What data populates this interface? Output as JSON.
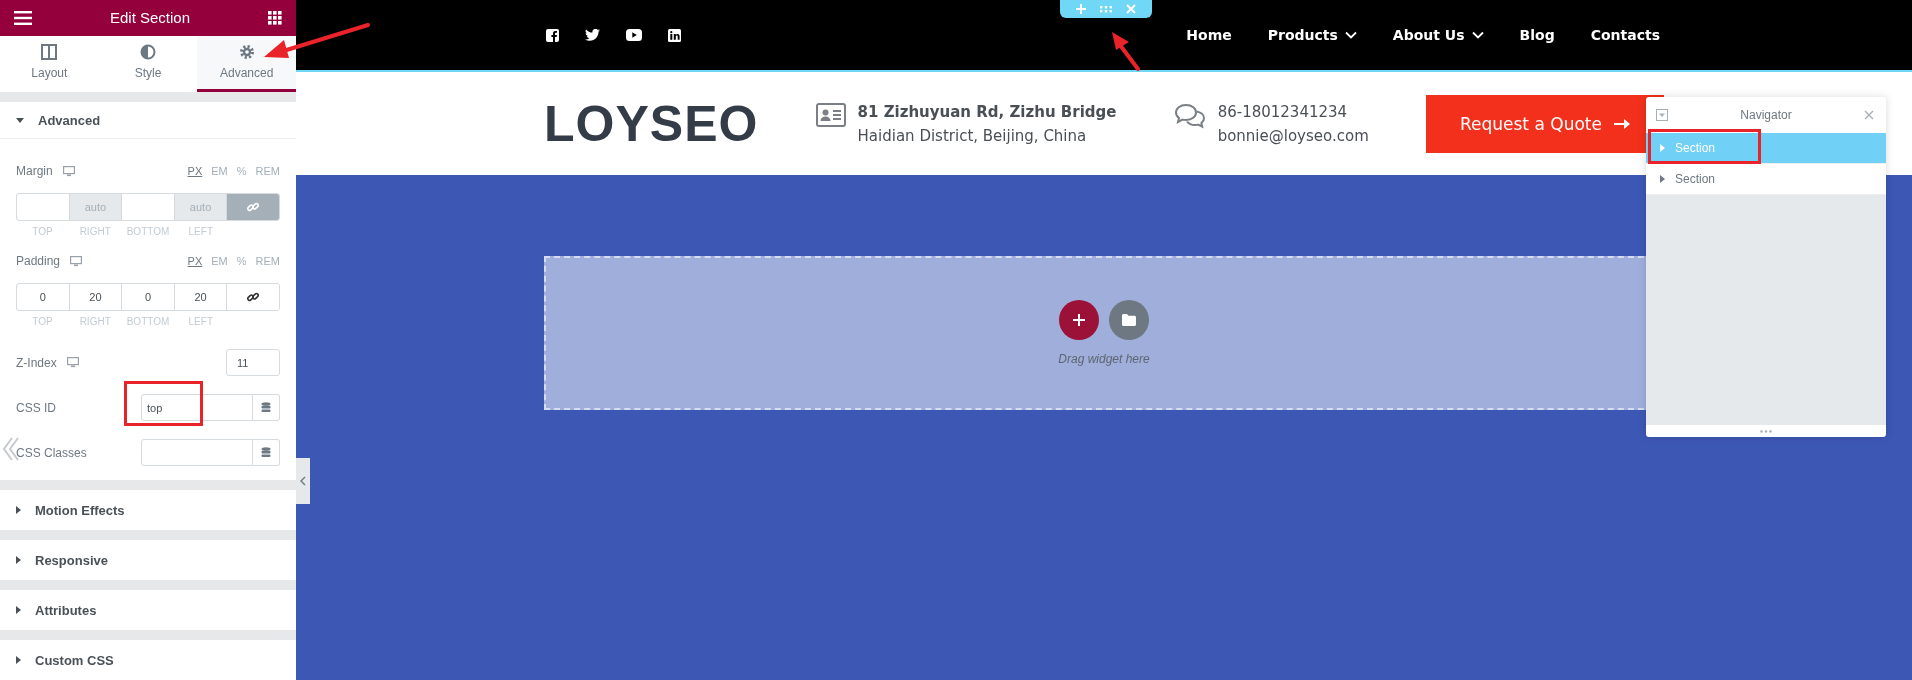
{
  "panel": {
    "title": "Edit Section",
    "tabs": [
      {
        "label": "Layout",
        "kind": "layout",
        "selected": false
      },
      {
        "label": "Style",
        "kind": "style",
        "selected": false
      },
      {
        "label": "Advanced",
        "kind": "advanced",
        "selected": true
      }
    ],
    "open_section": {
      "title": "Advanced",
      "expanded": true,
      "margin": {
        "label": "Margin",
        "units": [
          {
            "label": "PX",
            "selected": true
          },
          {
            "label": "EM",
            "selected": false
          },
          {
            "label": "%",
            "selected": false
          },
          {
            "label": "REM",
            "selected": false
          }
        ],
        "fields": [
          {
            "label": "TOP",
            "disabled": false
          },
          {
            "label": "RIGHT",
            "placeholder": "auto",
            "disabled": true
          },
          {
            "label": "BOTTOM",
            "disabled": false
          },
          {
            "label": "LEFT",
            "placeholder": "auto",
            "disabled": true
          }
        ],
        "linked": true
      },
      "padding": {
        "label": "Padding",
        "units": [
          {
            "label": "PX",
            "selected": true
          },
          {
            "label": "EM",
            "selected": false
          },
          {
            "label": "%",
            "selected": false
          },
          {
            "label": "REM",
            "selected": false
          }
        ],
        "fields": [
          {
            "label": "TOP",
            "value": "0",
            "disabled": false
          },
          {
            "label": "RIGHT",
            "value": "20",
            "disabled": false
          },
          {
            "label": "BOTTOM",
            "value": "0",
            "disabled": false
          },
          {
            "label": "LEFT",
            "value": "20",
            "disabled": false
          }
        ],
        "linked": false
      },
      "z_index": {
        "label": "Z-Index",
        "value": "11"
      },
      "css_id": {
        "label": "CSS ID",
        "value": "top"
      },
      "css_classes": {
        "label": "CSS Classes"
      }
    },
    "sections": [
      {
        "title": "Motion Effects",
        "expanded": false
      },
      {
        "title": "Responsive",
        "expanded": false
      },
      {
        "title": "Attributes",
        "expanded": false
      },
      {
        "title": "Custom CSS",
        "expanded": false
      }
    ]
  },
  "site": {
    "nav": [
      {
        "label": "Home",
        "dropdown": false
      },
      {
        "label": "Products",
        "dropdown": true
      },
      {
        "label": "About Us",
        "dropdown": true
      },
      {
        "label": "Blog",
        "dropdown": false
      },
      {
        "label": "Contacts",
        "dropdown": false
      }
    ],
    "logo": "LOYSEO",
    "address": [
      "81 Zizhuyuan Rd, Zizhu Bridge",
      "Haidian District, Beijing, China"
    ],
    "contact": [
      "86-18012341234",
      "bonnie@loyseo.com"
    ],
    "quote_button": "Request a Quote",
    "drop_hint": "Drag widget here"
  },
  "navigator": {
    "title": "Navigator",
    "items": [
      {
        "label": "Section",
        "selected": true
      },
      {
        "label": "Section",
        "selected": false
      }
    ]
  }
}
